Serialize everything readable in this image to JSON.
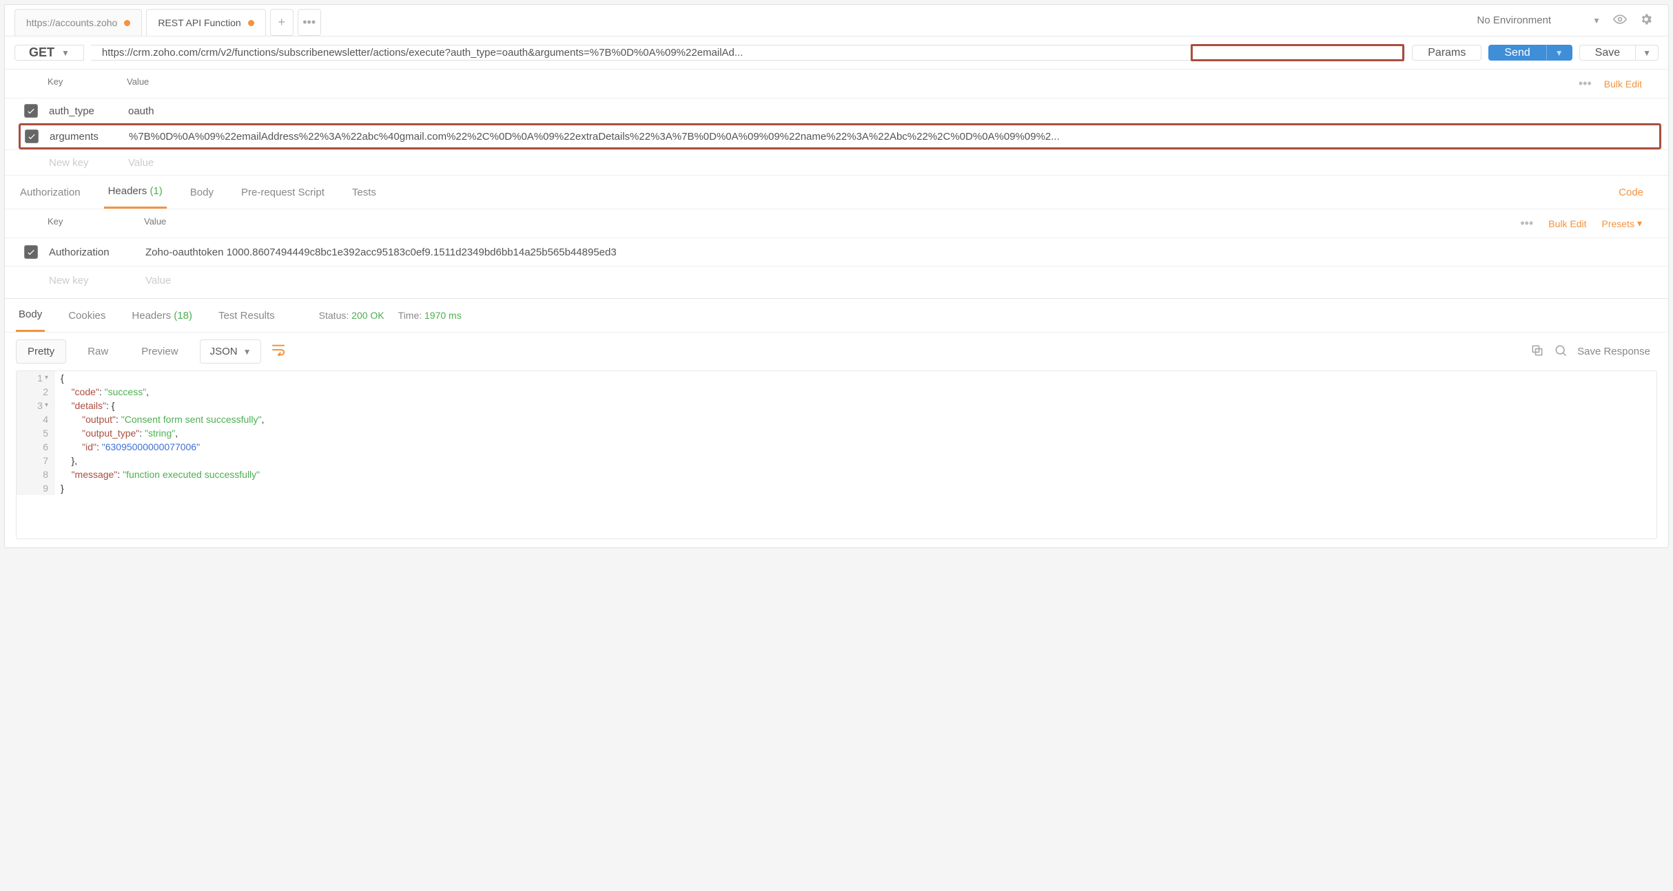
{
  "tabs": [
    {
      "label": "https://accounts.zoho",
      "active": false
    },
    {
      "label": "REST API Function",
      "active": true
    }
  ],
  "environment": {
    "label": "No Environment"
  },
  "request": {
    "method": "GET",
    "url": "https://crm.zoho.com/crm/v2/functions/subscribenewsletter/actions/execute?auth_type=oauth&arguments=%7B%0D%0A%09%22emailAd...",
    "params_button": "Params",
    "send_button": "Send",
    "save_button": "Save"
  },
  "params": {
    "header_key": "Key",
    "header_value": "Value",
    "bulk_edit": "Bulk Edit",
    "rows": [
      {
        "key": "auth_type",
        "value": "oauth",
        "checked": true
      },
      {
        "key": "arguments",
        "value": "%7B%0D%0A%09%22emailAddress%22%3A%22abc%40gmail.com%22%2C%0D%0A%09%22extraDetails%22%3A%7B%0D%0A%09%09%22name%22%3A%22Abc%22%2C%0D%0A%09%09%2...",
        "checked": true
      }
    ],
    "new_key": "New key",
    "new_value": "Value"
  },
  "req_tabs": {
    "authorization": "Authorization",
    "headers": "Headers",
    "headers_count": "(1)",
    "body": "Body",
    "prerequest": "Pre-request Script",
    "tests": "Tests",
    "code_link": "Code"
  },
  "headers_section": {
    "header_key": "Key",
    "header_value": "Value",
    "bulk_edit": "Bulk Edit",
    "presets": "Presets",
    "rows": [
      {
        "key": "Authorization",
        "value": "Zoho-oauthtoken 1000.8607494449c8bc1e392acc95183c0ef9.1511d2349bd6bb14a25b565b44895ed3",
        "checked": true
      }
    ],
    "new_key": "New key",
    "new_value": "Value"
  },
  "resp_tabs": {
    "body": "Body",
    "cookies": "Cookies",
    "headers": "Headers",
    "headers_count": "(18)",
    "test_results": "Test Results",
    "status_label": "Status:",
    "status_value": "200 OK",
    "time_label": "Time:",
    "time_value": "1970 ms"
  },
  "body_view": {
    "pretty": "Pretty",
    "raw": "Raw",
    "preview": "Preview",
    "format": "JSON",
    "save_response": "Save Response"
  },
  "response_json": {
    "lines": [
      {
        "n": "1",
        "fold": true,
        "html": "{"
      },
      {
        "n": "2",
        "html": "    <span class=\"tok-key\">\"code\"</span>: <span class=\"tok-str\">\"success\"</span>,"
      },
      {
        "n": "3",
        "fold": true,
        "html": "    <span class=\"tok-key\">\"details\"</span>: {"
      },
      {
        "n": "4",
        "html": "        <span class=\"tok-key\">\"output\"</span>: <span class=\"tok-str\">\"Consent form sent successfully\"</span>,"
      },
      {
        "n": "5",
        "html": "        <span class=\"tok-key\">\"output_type\"</span>: <span class=\"tok-str\">\"string\"</span>,"
      },
      {
        "n": "6",
        "html": "        <span class=\"tok-key\">\"id\"</span>: <span class=\"tok-num\">\"63095000000077006\"</span>"
      },
      {
        "n": "7",
        "html": "    },"
      },
      {
        "n": "8",
        "html": "    <span class=\"tok-key\">\"message\"</span>: <span class=\"tok-str\">\"function executed successfully\"</span>"
      },
      {
        "n": "9",
        "html": "}"
      }
    ]
  }
}
